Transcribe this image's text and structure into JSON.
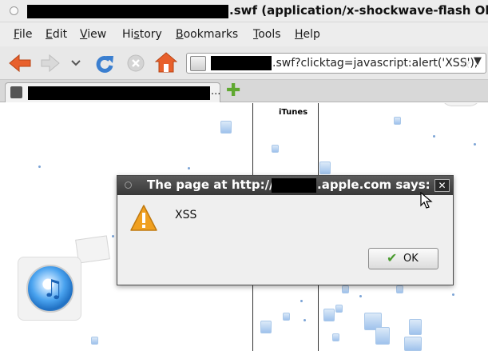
{
  "window": {
    "title_suffix": ".swf (application/x-shockwave-flash Obj"
  },
  "menu": [
    "File",
    "Edit",
    "View",
    "History",
    "Bookmarks",
    "Tools",
    "Help"
  ],
  "menu_mnemonics": [
    "F",
    "E",
    "V",
    "s",
    "B",
    "T",
    "H"
  ],
  "urlbar": {
    "url_suffix": ".swf?clicktag=javascript:alert('XSS');"
  },
  "tab": {
    "ellipsis": "..."
  },
  "content": {
    "itunes_label": "iTunes"
  },
  "dialog": {
    "title_prefix": "The page at http://",
    "title_suffix": ".apple.com says:",
    "message": "XSS",
    "ok_label": "OK",
    "close_glyph": "✕"
  },
  "icons": [
    "back-arrow-icon",
    "forward-arrow-icon",
    "reload-icon",
    "stop-icon",
    "home-icon",
    "site-identity-icon",
    "bookmark-star-icon",
    "dropdown-chevron-icon",
    "new-tab-plus-icon",
    "warning-icon",
    "checkmark-icon",
    "mouse-cursor-icon",
    "itunes-logo-icon",
    "music-note-icon"
  ],
  "colors": {
    "back_arrow": "#e8602c",
    "reload": "#3b7fd0",
    "home": "#e8602c",
    "dialog_title_bg": "#474747",
    "warning": "#f0a020",
    "ok_check": "#4a9b2f"
  }
}
